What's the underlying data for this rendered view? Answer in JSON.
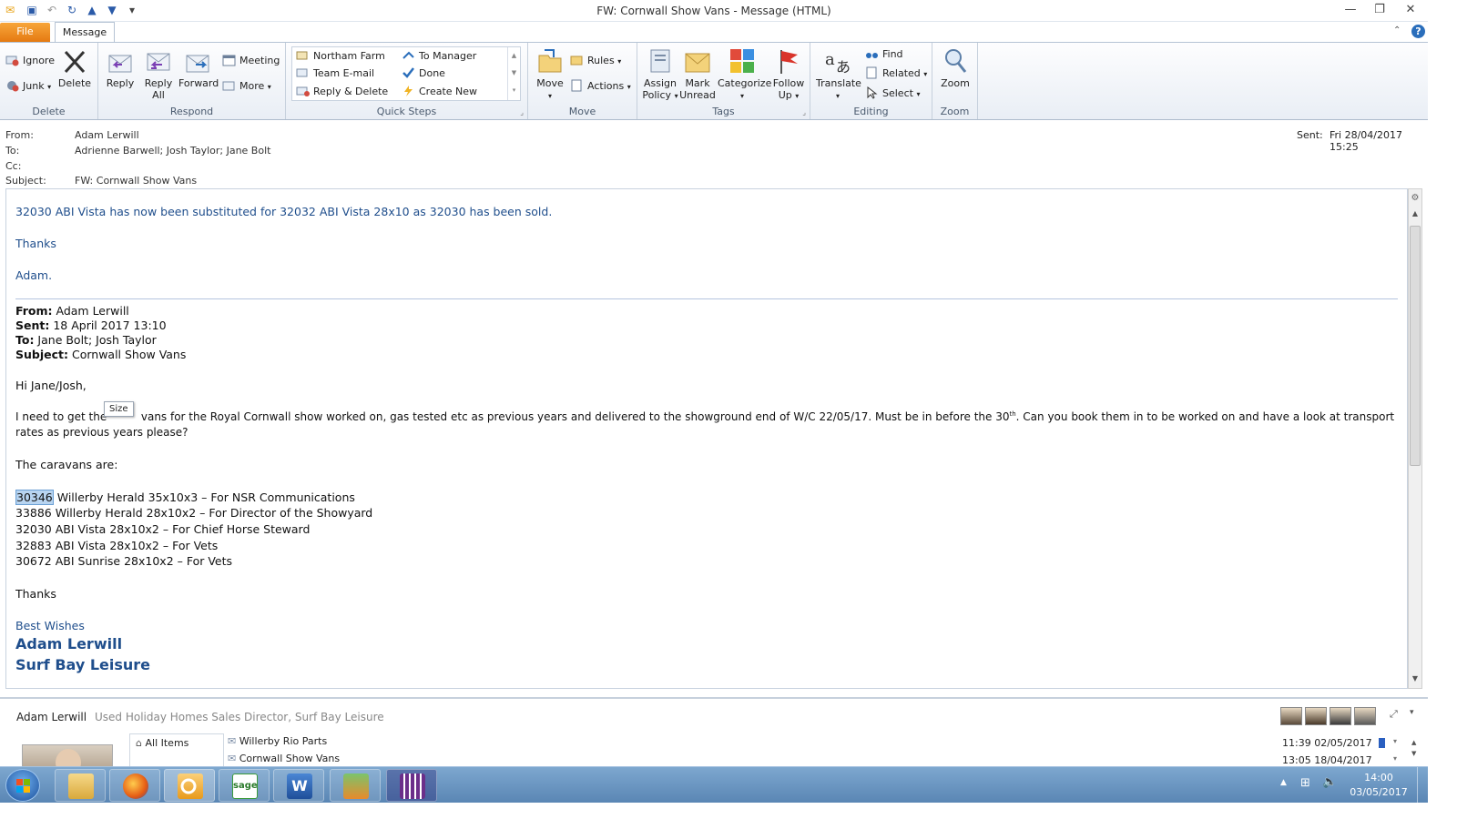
{
  "window": {
    "title": "FW: Cornwall Show Vans  -  Message (HTML)"
  },
  "tabs": {
    "file": "File",
    "message": "Message"
  },
  "ribbon": {
    "delete_group": {
      "label": "Delete",
      "ignore": "Ignore",
      "junk": "Junk",
      "delete": "Delete"
    },
    "respond_group": {
      "label": "Respond",
      "reply": "Reply",
      "reply_all_1": "Reply",
      "reply_all_2": "All",
      "forward": "Forward",
      "meeting": "Meeting",
      "more": "More"
    },
    "quick_steps": {
      "label": "Quick Steps",
      "items": [
        "Northam Farm",
        "Team E-mail",
        "Reply & Delete",
        "To Manager",
        "Done",
        "Create New"
      ]
    },
    "move_group": {
      "label": "Move",
      "move": "Move",
      "rules": "Rules",
      "actions": "Actions"
    },
    "tags_group": {
      "label": "Tags",
      "assign_1": "Assign",
      "assign_2": "Policy",
      "mark_1": "Mark",
      "mark_2": "Unread",
      "categorize": "Categorize",
      "follow_1": "Follow",
      "follow_2": "Up"
    },
    "editing_group": {
      "label": "Editing",
      "translate": "Translate",
      "find": "Find",
      "related": "Related",
      "select": "Select"
    },
    "zoom_group": {
      "label": "Zoom",
      "zoom": "Zoom"
    }
  },
  "header": {
    "from_label": "From:",
    "from": "Adam Lerwill",
    "to_label": "To:",
    "to": "Adrienne Barwell; Josh Taylor; Jane Bolt",
    "cc_label": "Cc:",
    "subject_label": "Subject:",
    "subject": "FW: Cornwall Show Vans",
    "sent_label": "Sent:",
    "sent": "Fri 28/04/2017 15:25"
  },
  "message": {
    "line1": "32030 ABI Vista has now been substituted for 32032 ABI Vista 28x10 as 32030 has been sold.",
    "thanks1": "Thanks",
    "adam": "Adam.",
    "fw_from_label": "From:",
    "fw_from": " Adam Lerwill",
    "fw_sent_label": "Sent:",
    "fw_sent": " 18 April 2017 13:10",
    "fw_to_label": "To:",
    "fw_to": " Jane Bolt; Josh Taylor",
    "fw_subject_label": "Subject:",
    "fw_subject": " Cornwall Show Vans",
    "greeting": "Hi Jane/Josh,",
    "para1_a": "I need to get the ",
    "tooltip": "Size",
    "para1_b": " vans for the Royal Cornwall show worked on, gas tested etc as previous years and delivered to the showground end of W/C 22/05/17.  Must be in before the 30",
    "para1_sup": "th",
    "para1_c": ".  Can you book them in to be worked on and have a look at transport",
    "para1_d": "rates as previous years please?",
    "caravans_intro": "The caravans are:",
    "first_id": "30346",
    "first_rest": " Willerby Herald 35x10x3 – For NSR Communications",
    "list": [
      "33886 Willerby Herald 28x10x2 – For Director of the Showyard",
      "32030 ABI Vista 28x10x2 – For Chief Horse Steward",
      "32883 ABI Vista 28x10x2 – For Vets",
      "30672 ABI Sunrise 28x10x2 – For Vets"
    ],
    "thanks2": "Thanks",
    "best": "Best Wishes",
    "sig_name": "Adam Lerwill",
    "sig_company": "Surf Bay Leisure"
  },
  "people_pane": {
    "name": "Adam Lerwill",
    "role": "Used Holiday Homes Sales Director, Surf Bay Leisure",
    "all_items": "All Items",
    "items": [
      {
        "subject": "Willerby Rio Parts",
        "date": "11:39 02/05/2017"
      },
      {
        "subject": "Cornwall Show Vans",
        "date": "13:05 18/04/2017"
      }
    ]
  },
  "taskbar": {
    "time": "14:00",
    "date": "03/05/2017",
    "sage": "sage"
  }
}
